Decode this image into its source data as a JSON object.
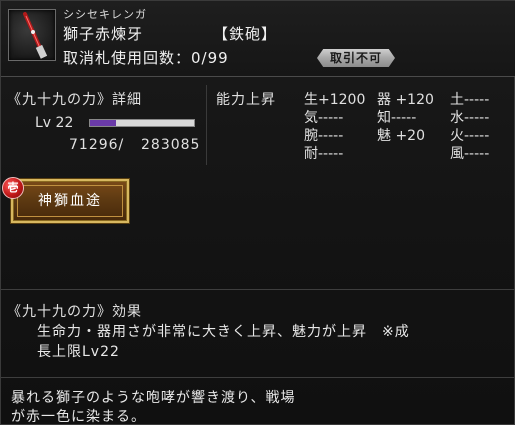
{
  "item": {
    "furigana": "シシセキレンガ",
    "name": "獅子赤煉牙",
    "type": "【鉄砲】",
    "usage": "取消札使用回数：0/99",
    "trade_status": "取引不可",
    "icon": "rifle-icon"
  },
  "skill": {
    "title": "《九十九の力》詳細",
    "level_label": "Lv 22",
    "level_progress": 0.25,
    "exp_current": "71296/",
    "exp_max": "283085"
  },
  "stats": {
    "title": "能力上昇",
    "entries": [
      {
        "text": "生+1200"
      },
      {
        "text": "器 +120"
      },
      {
        "text": "土-----"
      },
      {
        "text": "気-----"
      },
      {
        "text": "知-----"
      },
      {
        "text": "水-----"
      },
      {
        "text": "腕-----"
      },
      {
        "text": "魅  +20"
      },
      {
        "text": "火-----"
      },
      {
        "text": "耐-----"
      },
      {
        "text": "風-----"
      }
    ]
  },
  "skill_button": {
    "rank_mark": "壱",
    "label": "神獅血途"
  },
  "effect": {
    "title": "《九十九の力》効果",
    "line1": "生命力・器用さが非常に大きく上昇、魅力が上昇　※成",
    "line2": "長上限Lv22"
  },
  "flavor": {
    "line1": "暴れる獅子のような咆哮が響き渡り、戦場",
    "line2": "が赤一色に染まる。"
  },
  "colors": {
    "level_bar_fill": "#6a3aa8",
    "skill_button": "#5e3a12",
    "skill_button_border": "#d8b860",
    "rank_mark": "#c01818"
  }
}
